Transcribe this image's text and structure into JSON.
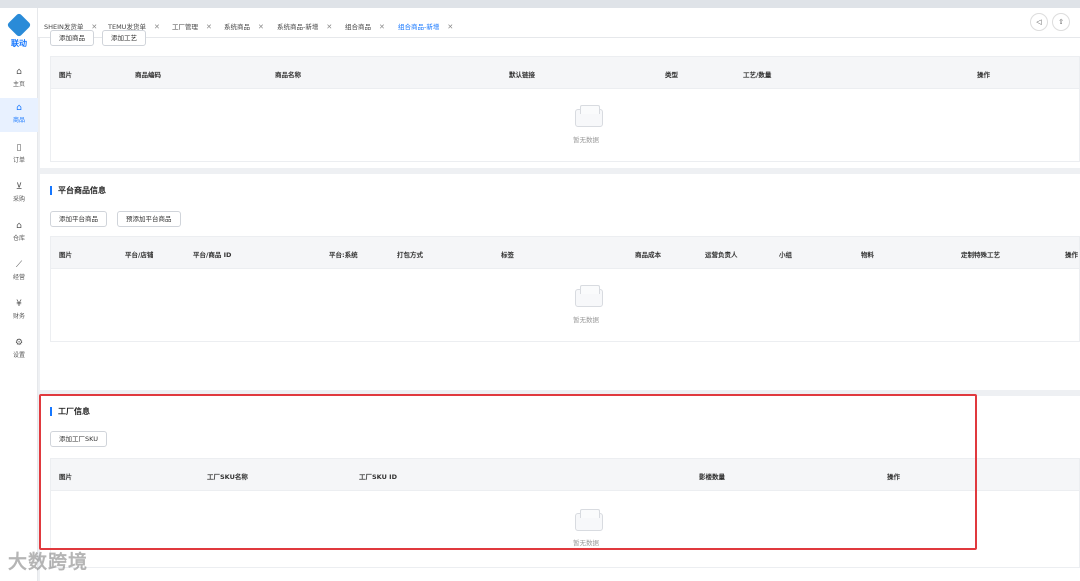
{
  "sidebar": {
    "logo_text": "联动",
    "items": [
      {
        "label": "主页",
        "icon": "home-icon"
      },
      {
        "label": "商品",
        "icon": "shop-icon"
      },
      {
        "label": "订单",
        "icon": "order-icon"
      },
      {
        "label": "采购",
        "icon": "cart-icon"
      },
      {
        "label": "仓库",
        "icon": "warehouse-icon"
      },
      {
        "label": "经营",
        "icon": "chart-icon"
      },
      {
        "label": "财务",
        "icon": "finance-icon"
      },
      {
        "label": "设置",
        "icon": "gear-icon"
      }
    ]
  },
  "tabs": [
    {
      "label": "SHEIN发货单"
    },
    {
      "label": "TEMU发货单"
    },
    {
      "label": "工厂管理"
    },
    {
      "label": "系统商品"
    },
    {
      "label": "系统商品-新增"
    },
    {
      "label": "组合商品"
    },
    {
      "label": "组合商品-新增"
    }
  ],
  "section1": {
    "buttons": [
      "添加商品",
      "添加工艺"
    ],
    "columns": [
      "图片",
      "商品编码",
      "商品名称",
      "默认链接",
      "类型",
      "工艺/数量",
      "操作"
    ],
    "empty_text": "暂无数据"
  },
  "section2": {
    "title": "平台商品信息",
    "buttons": [
      "添加平台商品",
      "预添加平台商品"
    ],
    "columns": [
      "图片",
      "平台/店铺",
      "平台/商品 ID",
      "平台:系统",
      "打包方式",
      "标签",
      "商品成本",
      "运营负责人",
      "小组",
      "物料",
      "定制特殊工艺",
      "操作"
    ],
    "empty_text": "暂无数据"
  },
  "section3": {
    "title": "工厂信息",
    "buttons": [
      "添加工厂SKU"
    ],
    "columns": [
      "图片",
      "工厂SKU名称",
      "工厂SKU ID",
      "影楼数量",
      "操作"
    ],
    "empty_text": "暂无数据"
  },
  "watermark": "大数跨境",
  "colors": {
    "accent": "#1677ff",
    "highlight": "#e0393e"
  }
}
